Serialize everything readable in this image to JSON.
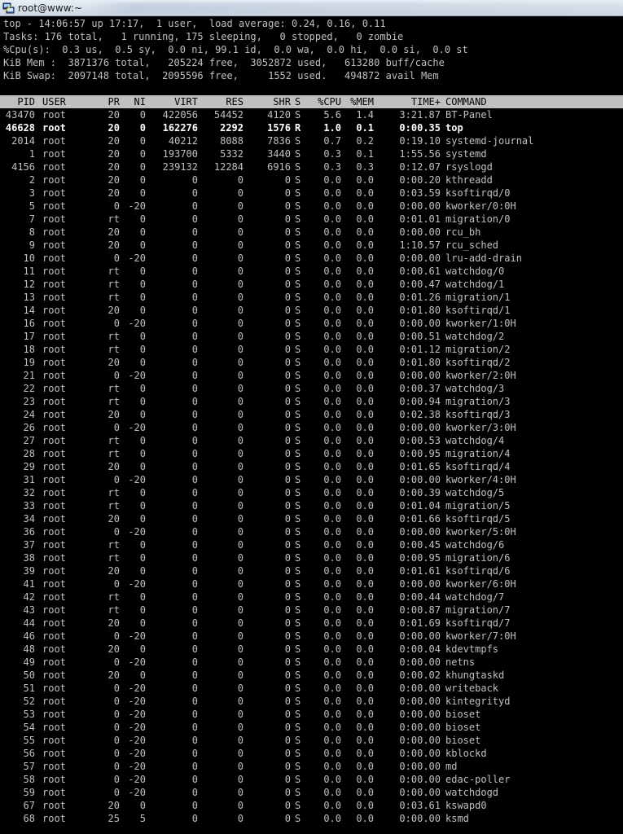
{
  "window": {
    "title": "root@www:~"
  },
  "summary": [
    "top - 14:06:57 up 17:17,  1 user,  load average: 0.24, 0.16, 0.11",
    "Tasks: 176 total,   1 running, 175 sleeping,   0 stopped,   0 zombie",
    "%Cpu(s):  0.3 us,  0.5 sy,  0.0 ni, 99.1 id,  0.0 wa,  0.0 hi,  0.0 si,  0.0 st",
    "KiB Mem :  3871376 total,   205224 free,  3052872 used,   613280 buff/cache",
    "KiB Swap:  2097148 total,  2095596 free,     1552 used.   494872 avail Mem"
  ],
  "columns": [
    "PID",
    "USER",
    "PR",
    "NI",
    "VIRT",
    "RES",
    "SHR",
    "S",
    "%CPU",
    "%MEM",
    "TIME+",
    "COMMAND"
  ],
  "processes": [
    [
      "43470",
      "root",
      "20",
      "0",
      "422056",
      "54452",
      "4120",
      "S",
      "5.6",
      "1.4",
      "3:21.87",
      "BT-Panel"
    ],
    [
      "46628",
      "root",
      "20",
      "0",
      "162276",
      "2292",
      "1576",
      "R",
      "1.0",
      "0.1",
      "0:00.35",
      "top"
    ],
    [
      "2014",
      "root",
      "20",
      "0",
      "40212",
      "8088",
      "7836",
      "S",
      "0.7",
      "0.2",
      "0:19.10",
      "systemd-journal"
    ],
    [
      "1",
      "root",
      "20",
      "0",
      "193700",
      "5332",
      "3440",
      "S",
      "0.3",
      "0.1",
      "1:55.56",
      "systemd"
    ],
    [
      "4156",
      "root",
      "20",
      "0",
      "239132",
      "12284",
      "6916",
      "S",
      "0.3",
      "0.3",
      "0:12.07",
      "rsyslogd"
    ],
    [
      "2",
      "root",
      "20",
      "0",
      "0",
      "0",
      "0",
      "S",
      "0.0",
      "0.0",
      "0:00.20",
      "kthreadd"
    ],
    [
      "3",
      "root",
      "20",
      "0",
      "0",
      "0",
      "0",
      "S",
      "0.0",
      "0.0",
      "0:03.59",
      "ksoftirqd/0"
    ],
    [
      "5",
      "root",
      "0",
      "-20",
      "0",
      "0",
      "0",
      "S",
      "0.0",
      "0.0",
      "0:00.00",
      "kworker/0:0H"
    ],
    [
      "7",
      "root",
      "rt",
      "0",
      "0",
      "0",
      "0",
      "S",
      "0.0",
      "0.0",
      "0:01.01",
      "migration/0"
    ],
    [
      "8",
      "root",
      "20",
      "0",
      "0",
      "0",
      "0",
      "S",
      "0.0",
      "0.0",
      "0:00.00",
      "rcu_bh"
    ],
    [
      "9",
      "root",
      "20",
      "0",
      "0",
      "0",
      "0",
      "S",
      "0.0",
      "0.0",
      "1:10.57",
      "rcu_sched"
    ],
    [
      "10",
      "root",
      "0",
      "-20",
      "0",
      "0",
      "0",
      "S",
      "0.0",
      "0.0",
      "0:00.00",
      "lru-add-drain"
    ],
    [
      "11",
      "root",
      "rt",
      "0",
      "0",
      "0",
      "0",
      "S",
      "0.0",
      "0.0",
      "0:00.61",
      "watchdog/0"
    ],
    [
      "12",
      "root",
      "rt",
      "0",
      "0",
      "0",
      "0",
      "S",
      "0.0",
      "0.0",
      "0:00.47",
      "watchdog/1"
    ],
    [
      "13",
      "root",
      "rt",
      "0",
      "0",
      "0",
      "0",
      "S",
      "0.0",
      "0.0",
      "0:01.26",
      "migration/1"
    ],
    [
      "14",
      "root",
      "20",
      "0",
      "0",
      "0",
      "0",
      "S",
      "0.0",
      "0.0",
      "0:01.80",
      "ksoftirqd/1"
    ],
    [
      "16",
      "root",
      "0",
      "-20",
      "0",
      "0",
      "0",
      "S",
      "0.0",
      "0.0",
      "0:00.00",
      "kworker/1:0H"
    ],
    [
      "17",
      "root",
      "rt",
      "0",
      "0",
      "0",
      "0",
      "S",
      "0.0",
      "0.0",
      "0:00.51",
      "watchdog/2"
    ],
    [
      "18",
      "root",
      "rt",
      "0",
      "0",
      "0",
      "0",
      "S",
      "0.0",
      "0.0",
      "0:01.12",
      "migration/2"
    ],
    [
      "19",
      "root",
      "20",
      "0",
      "0",
      "0",
      "0",
      "S",
      "0.0",
      "0.0",
      "0:01.80",
      "ksoftirqd/2"
    ],
    [
      "21",
      "root",
      "0",
      "-20",
      "0",
      "0",
      "0",
      "S",
      "0.0",
      "0.0",
      "0:00.00",
      "kworker/2:0H"
    ],
    [
      "22",
      "root",
      "rt",
      "0",
      "0",
      "0",
      "0",
      "S",
      "0.0",
      "0.0",
      "0:00.37",
      "watchdog/3"
    ],
    [
      "23",
      "root",
      "rt",
      "0",
      "0",
      "0",
      "0",
      "S",
      "0.0",
      "0.0",
      "0:00.94",
      "migration/3"
    ],
    [
      "24",
      "root",
      "20",
      "0",
      "0",
      "0",
      "0",
      "S",
      "0.0",
      "0.0",
      "0:02.38",
      "ksoftirqd/3"
    ],
    [
      "26",
      "root",
      "0",
      "-20",
      "0",
      "0",
      "0",
      "S",
      "0.0",
      "0.0",
      "0:00.00",
      "kworker/3:0H"
    ],
    [
      "27",
      "root",
      "rt",
      "0",
      "0",
      "0",
      "0",
      "S",
      "0.0",
      "0.0",
      "0:00.53",
      "watchdog/4"
    ],
    [
      "28",
      "root",
      "rt",
      "0",
      "0",
      "0",
      "0",
      "S",
      "0.0",
      "0.0",
      "0:00.95",
      "migration/4"
    ],
    [
      "29",
      "root",
      "20",
      "0",
      "0",
      "0",
      "0",
      "S",
      "0.0",
      "0.0",
      "0:01.65",
      "ksoftirqd/4"
    ],
    [
      "31",
      "root",
      "0",
      "-20",
      "0",
      "0",
      "0",
      "S",
      "0.0",
      "0.0",
      "0:00.00",
      "kworker/4:0H"
    ],
    [
      "32",
      "root",
      "rt",
      "0",
      "0",
      "0",
      "0",
      "S",
      "0.0",
      "0.0",
      "0:00.39",
      "watchdog/5"
    ],
    [
      "33",
      "root",
      "rt",
      "0",
      "0",
      "0",
      "0",
      "S",
      "0.0",
      "0.0",
      "0:01.04",
      "migration/5"
    ],
    [
      "34",
      "root",
      "20",
      "0",
      "0",
      "0",
      "0",
      "S",
      "0.0",
      "0.0",
      "0:01.66",
      "ksoftirqd/5"
    ],
    [
      "36",
      "root",
      "0",
      "-20",
      "0",
      "0",
      "0",
      "S",
      "0.0",
      "0.0",
      "0:00.00",
      "kworker/5:0H"
    ],
    [
      "37",
      "root",
      "rt",
      "0",
      "0",
      "0",
      "0",
      "S",
      "0.0",
      "0.0",
      "0:00.45",
      "watchdog/6"
    ],
    [
      "38",
      "root",
      "rt",
      "0",
      "0",
      "0",
      "0",
      "S",
      "0.0",
      "0.0",
      "0:00.95",
      "migration/6"
    ],
    [
      "39",
      "root",
      "20",
      "0",
      "0",
      "0",
      "0",
      "S",
      "0.0",
      "0.0",
      "0:01.61",
      "ksoftirqd/6"
    ],
    [
      "41",
      "root",
      "0",
      "-20",
      "0",
      "0",
      "0",
      "S",
      "0.0",
      "0.0",
      "0:00.00",
      "kworker/6:0H"
    ],
    [
      "42",
      "root",
      "rt",
      "0",
      "0",
      "0",
      "0",
      "S",
      "0.0",
      "0.0",
      "0:00.44",
      "watchdog/7"
    ],
    [
      "43",
      "root",
      "rt",
      "0",
      "0",
      "0",
      "0",
      "S",
      "0.0",
      "0.0",
      "0:00.87",
      "migration/7"
    ],
    [
      "44",
      "root",
      "20",
      "0",
      "0",
      "0",
      "0",
      "S",
      "0.0",
      "0.0",
      "0:01.69",
      "ksoftirqd/7"
    ],
    [
      "46",
      "root",
      "0",
      "-20",
      "0",
      "0",
      "0",
      "S",
      "0.0",
      "0.0",
      "0:00.00",
      "kworker/7:0H"
    ],
    [
      "48",
      "root",
      "20",
      "0",
      "0",
      "0",
      "0",
      "S",
      "0.0",
      "0.0",
      "0:00.04",
      "kdevtmpfs"
    ],
    [
      "49",
      "root",
      "0",
      "-20",
      "0",
      "0",
      "0",
      "S",
      "0.0",
      "0.0",
      "0:00.00",
      "netns"
    ],
    [
      "50",
      "root",
      "20",
      "0",
      "0",
      "0",
      "0",
      "S",
      "0.0",
      "0.0",
      "0:00.02",
      "khungtaskd"
    ],
    [
      "51",
      "root",
      "0",
      "-20",
      "0",
      "0",
      "0",
      "S",
      "0.0",
      "0.0",
      "0:00.00",
      "writeback"
    ],
    [
      "52",
      "root",
      "0",
      "-20",
      "0",
      "0",
      "0",
      "S",
      "0.0",
      "0.0",
      "0:00.00",
      "kintegrityd"
    ],
    [
      "53",
      "root",
      "0",
      "-20",
      "0",
      "0",
      "0",
      "S",
      "0.0",
      "0.0",
      "0:00.00",
      "bioset"
    ],
    [
      "54",
      "root",
      "0",
      "-20",
      "0",
      "0",
      "0",
      "S",
      "0.0",
      "0.0",
      "0:00.00",
      "bioset"
    ],
    [
      "55",
      "root",
      "0",
      "-20",
      "0",
      "0",
      "0",
      "S",
      "0.0",
      "0.0",
      "0:00.00",
      "bioset"
    ],
    [
      "56",
      "root",
      "0",
      "-20",
      "0",
      "0",
      "0",
      "S",
      "0.0",
      "0.0",
      "0:00.00",
      "kblockd"
    ],
    [
      "57",
      "root",
      "0",
      "-20",
      "0",
      "0",
      "0",
      "S",
      "0.0",
      "0.0",
      "0:00.00",
      "md"
    ],
    [
      "58",
      "root",
      "0",
      "-20",
      "0",
      "0",
      "0",
      "S",
      "0.0",
      "0.0",
      "0:00.00",
      "edac-poller"
    ],
    [
      "59",
      "root",
      "0",
      "-20",
      "0",
      "0",
      "0",
      "S",
      "0.0",
      "0.0",
      "0:00.00",
      "watchdogd"
    ],
    [
      "67",
      "root",
      "20",
      "0",
      "0",
      "0",
      "0",
      "S",
      "0.0",
      "0.0",
      "0:03.61",
      "kswapd0"
    ],
    [
      "68",
      "root",
      "25",
      "5",
      "0",
      "0",
      "0",
      "S",
      "0.0",
      "0.0",
      "0:00.00",
      "ksmd"
    ]
  ]
}
